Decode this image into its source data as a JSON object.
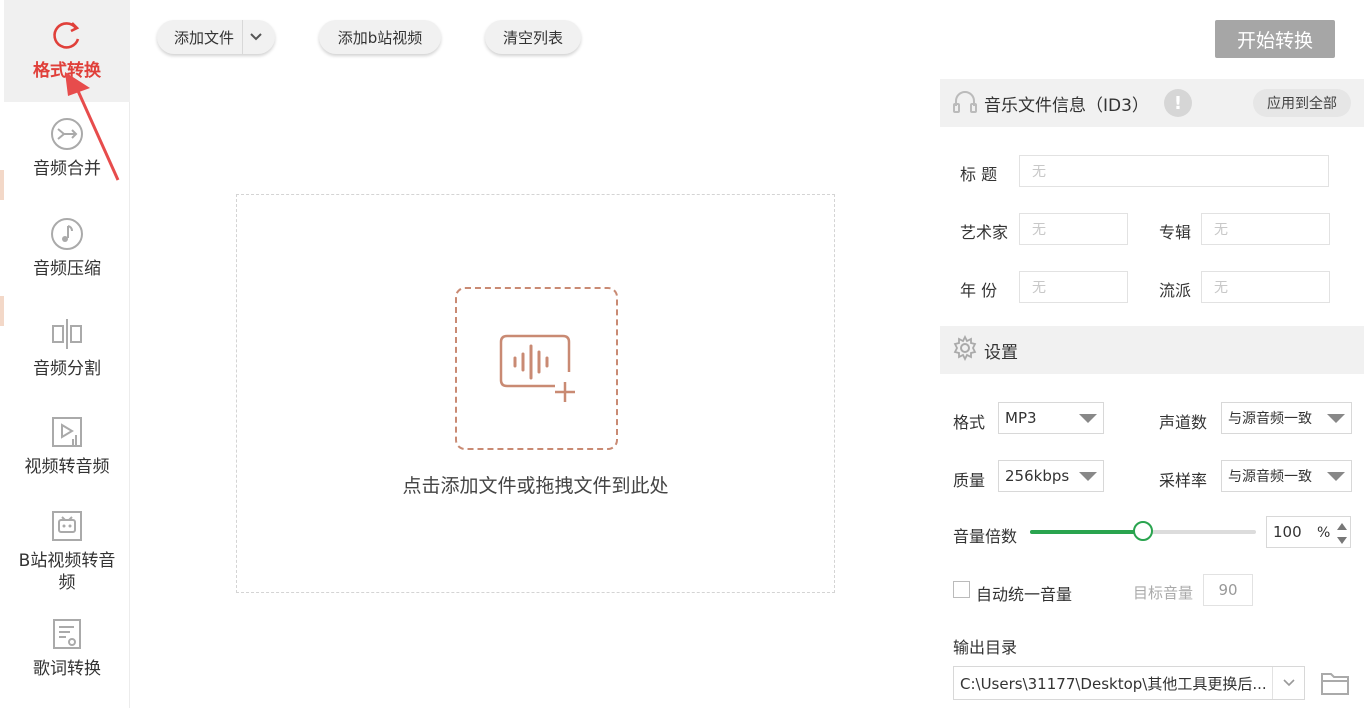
{
  "sidebar": {
    "items": [
      {
        "label": "格式转换",
        "icon": "refresh-circle-icon",
        "active": true
      },
      {
        "label": "音频合并",
        "icon": "merge-icon",
        "active": false
      },
      {
        "label": "音频压缩",
        "icon": "music-note-icon",
        "active": false
      },
      {
        "label": "音频分割",
        "icon": "split-icon",
        "active": false
      },
      {
        "label": "视频转音频",
        "icon": "video-to-audio-icon",
        "active": false
      },
      {
        "label": "B站视频转音频",
        "icon": "bilibili-tv-icon",
        "active": false
      },
      {
        "label": "歌词转换",
        "icon": "lyrics-icon",
        "active": false
      }
    ]
  },
  "toolbar": {
    "add_file": "添加文件",
    "add_bilibili": "添加b站视频",
    "clear_list": "清空列表",
    "start": "开始转换"
  },
  "dropzone": {
    "text": "点击添加文件或拖拽文件到此处",
    "icon": "audio-add-icon"
  },
  "id3": {
    "title": "音乐文件信息（ID3）",
    "apply_all": "应用到全部",
    "info_icon": "!",
    "fields": {
      "title_label": "标  题",
      "artist_label": "艺术家",
      "album_label": "专辑",
      "year_label": "年  份",
      "genre_label": "流派",
      "placeholder": "无"
    }
  },
  "settings": {
    "title": "设置",
    "format_label": "格式",
    "format_value": "MP3",
    "channels_label": "声道数",
    "channels_value": "与源音频一致",
    "quality_label": "质量",
    "quality_value": "256kbps",
    "samplerate_label": "采样率",
    "samplerate_value": "与源音频一致",
    "volume_label": "音量倍数",
    "volume_value": "100",
    "volume_unit": "%",
    "volume_fraction": 0.5,
    "auto_volume_label": "自动统一音量",
    "target_volume_label": "目标音量",
    "target_volume_value": "90",
    "output_label": "输出目录",
    "output_path": "C:\\Users\\31177\\Desktop\\其他工具更换后..."
  },
  "colors": {
    "accent_red": "#e0403a",
    "slider_green": "#2aa44f",
    "drop_border": "#c98a73",
    "start_button": "#a6a6a6"
  }
}
